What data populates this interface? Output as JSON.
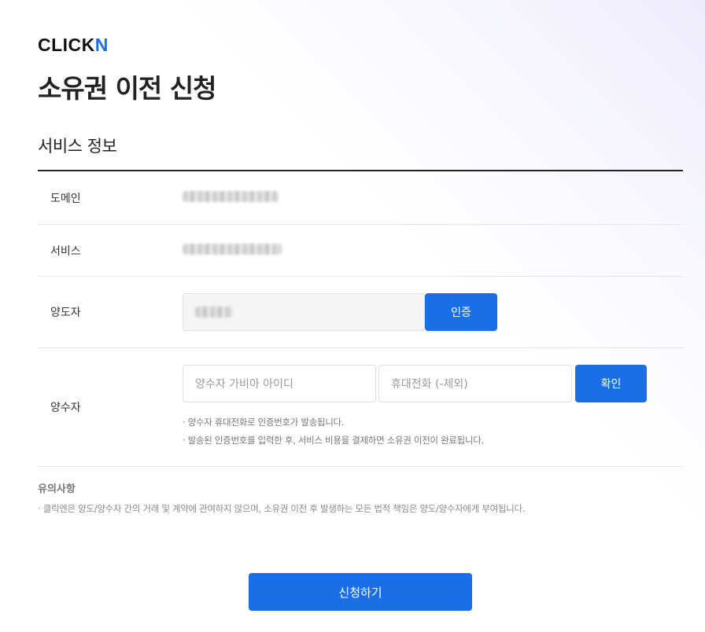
{
  "brand": {
    "logo_main": "CLICK",
    "logo_accent": "N"
  },
  "page": {
    "title": "소유권 이전 신청"
  },
  "section": {
    "title": "서비스 정보"
  },
  "rows": {
    "domain": {
      "label": "도메인"
    },
    "service": {
      "label": "서비스"
    },
    "transferor": {
      "label": "양도자",
      "verify_label": "인증"
    },
    "transferee": {
      "label": "양수자",
      "id_placeholder": "양수자 가비아 아이디",
      "phone_placeholder": "휴대전화 (-제외)",
      "confirm_label": "확인",
      "hints": [
        "· 양수자 휴대전화로 인증번호가 발송됩니다.",
        "· 발송된 인증번호를 입력한 후, 서비스 비용을 결제하면 소유권 이전이 완료됩니다."
      ]
    }
  },
  "notice": {
    "title": "유의사항",
    "text": "· 클릭엔은 양도/양수자 간의 거래 및 계약에 관여하지 않으며, 소유권 이전 후 발생하는 모든 법적 책임은 양도/양수자에게 부여됩니다."
  },
  "actions": {
    "submit_label": "신청하기"
  },
  "colors": {
    "accent": "#1a6fe6",
    "text": "#222222",
    "border": "#e5e5e5"
  }
}
